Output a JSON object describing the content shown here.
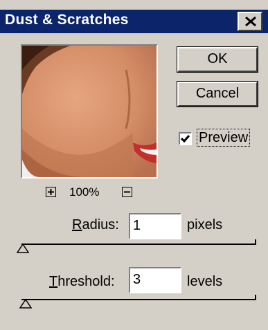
{
  "dialog": {
    "title": "Dust & Scratches"
  },
  "buttons": {
    "ok_label": "OK",
    "cancel_label": "Cancel"
  },
  "preview": {
    "checkbox_label": "Preview",
    "checked": true,
    "zoom_level": "100%",
    "zoom_in_symbol": "+",
    "zoom_out_symbol": "−"
  },
  "radius": {
    "label_underlined": "R",
    "label_rest": "adius:",
    "value": "1",
    "unit": "pixels",
    "slider_fraction": 0.0
  },
  "threshold": {
    "label_underlined": "T",
    "label_rest": "hreshold:",
    "value": "3",
    "unit": "levels",
    "slider_fraction": 0.012
  },
  "icons": {
    "close": "close-icon",
    "zoom_in": "zoom-in-icon",
    "zoom_out": "zoom-out-icon",
    "checkmark": "checkmark-icon",
    "slider_thumb": "triangle-thumb-icon"
  },
  "colors": {
    "titlebar": "#0b246a",
    "dialog_bg": "#d4d0c8"
  }
}
